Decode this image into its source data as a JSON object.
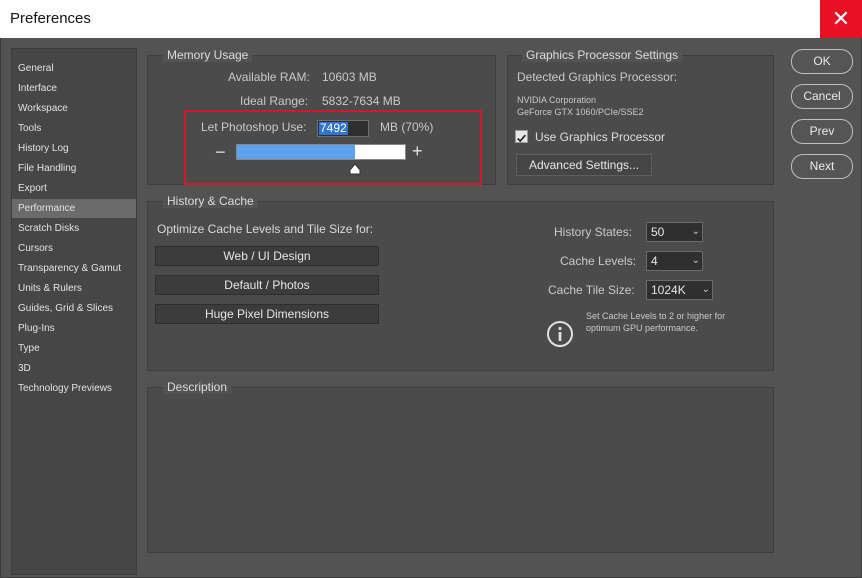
{
  "window": {
    "title": "Preferences",
    "close_glyph": "✕"
  },
  "sidebar": {
    "items": [
      {
        "label": "General"
      },
      {
        "label": "Interface"
      },
      {
        "label": "Workspace"
      },
      {
        "label": "Tools"
      },
      {
        "label": "History Log"
      },
      {
        "label": "File Handling"
      },
      {
        "label": "Export"
      },
      {
        "label": "Performance",
        "selected": true
      },
      {
        "label": "Scratch Disks"
      },
      {
        "label": "Cursors"
      },
      {
        "label": "Transparency & Gamut"
      },
      {
        "label": "Units & Rulers"
      },
      {
        "label": "Guides, Grid & Slices"
      },
      {
        "label": "Plug-Ins"
      },
      {
        "label": "Type"
      },
      {
        "label": "3D"
      },
      {
        "label": "Technology Previews"
      }
    ]
  },
  "memory": {
    "title": "Memory Usage",
    "available_label": "Available RAM:",
    "available_value": "10603 MB",
    "ideal_label": "Ideal Range:",
    "ideal_value": "5832-7634 MB",
    "let_use_label": "Let Photoshop Use:",
    "let_use_value": "7492",
    "percent_text": "MB (70%)",
    "slider_fraction": 0.7,
    "minus": "−",
    "plus": "+"
  },
  "gpu": {
    "title": "Graphics Processor Settings",
    "detected_label": "Detected Graphics Processor:",
    "vendor": "NVIDIA Corporation",
    "model": "GeForce GTX 1060/PCIe/SSE2",
    "use_gpu_label": "Use Graphics Processor",
    "use_gpu_checked": true,
    "advanced_button": "Advanced Settings..."
  },
  "history": {
    "title": "History & Cache",
    "optimize_label": "Optimize Cache Levels and Tile Size for:",
    "preset_buttons": [
      "Web / UI Design",
      "Default / Photos",
      "Huge Pixel Dimensions"
    ],
    "history_states_label": "History States:",
    "history_states_value": "50",
    "cache_levels_label": "Cache Levels:",
    "cache_levels_value": "4",
    "tile_size_label": "Cache Tile Size:",
    "tile_size_value": "1024K",
    "info_line1": "Set Cache Levels to 2 or higher for",
    "info_line2": "optimum GPU performance.",
    "info_icon": "info-icon"
  },
  "description": {
    "title": "Description",
    "text": ""
  },
  "actions": {
    "ok": "OK",
    "cancel": "Cancel",
    "prev": "Prev",
    "next": "Next"
  },
  "colors": {
    "close_red": "#e81123",
    "slider_blue": "#5da1ee",
    "highlight_red": "#d0192c",
    "selection_blue": "#2f73d6",
    "background": "#535353"
  }
}
